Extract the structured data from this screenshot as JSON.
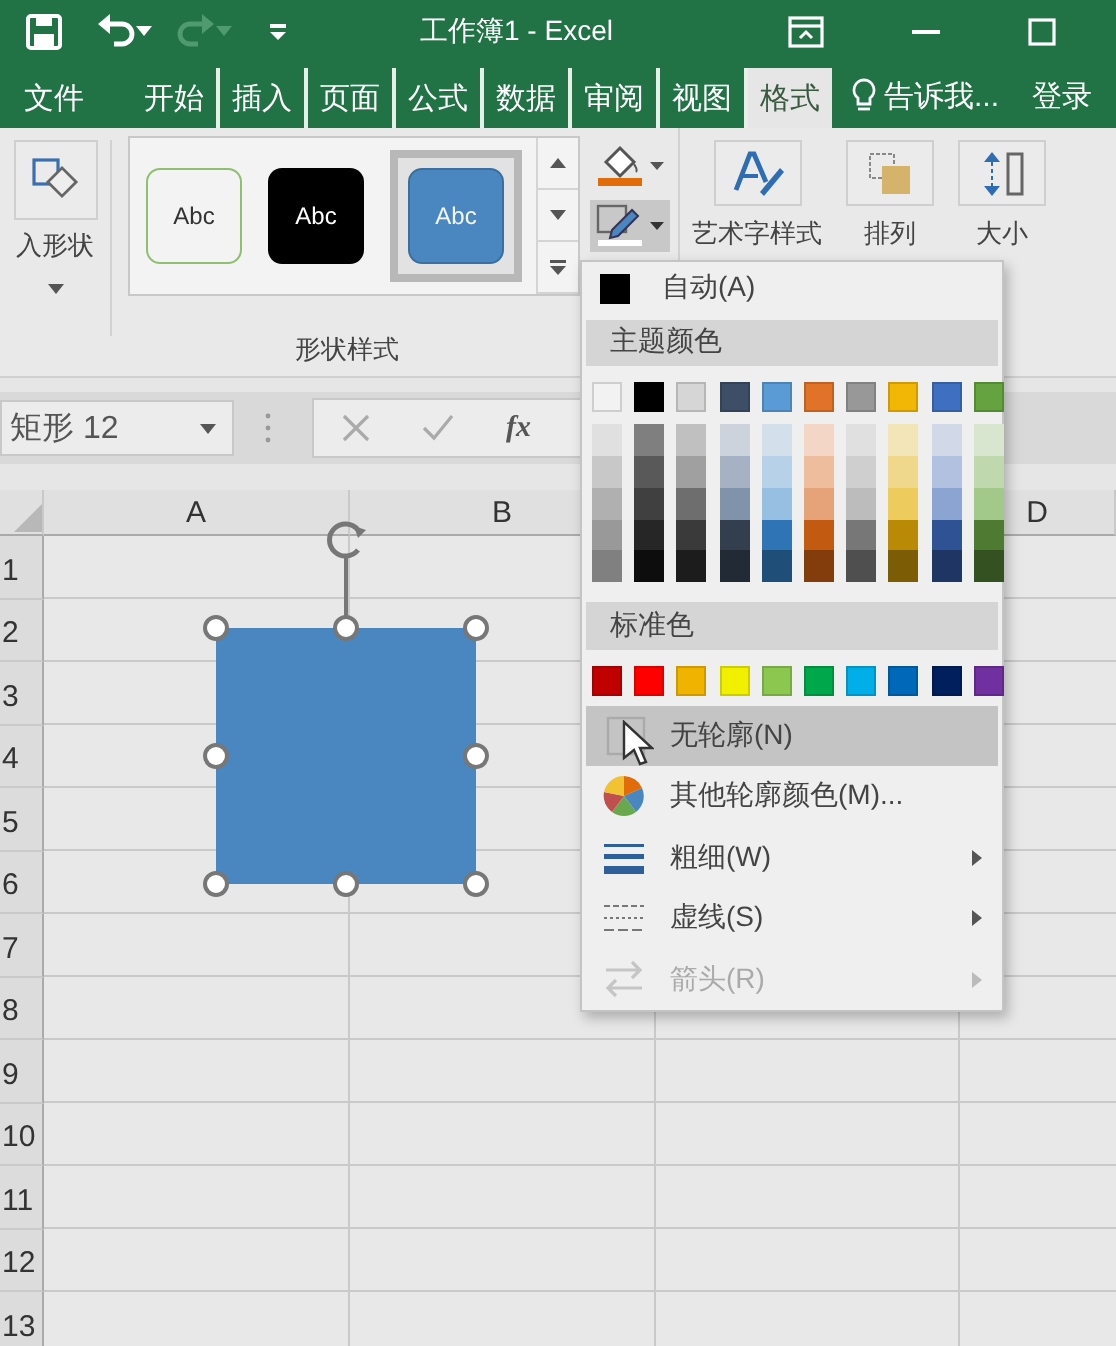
{
  "title_bar": {
    "title": "工作簿1 - Excel"
  },
  "ribbon_tabs": [
    {
      "label": "文件",
      "selected": false
    },
    {
      "label": "开始",
      "selected": false
    },
    {
      "label": "插入",
      "selected": false
    },
    {
      "label": "页面",
      "selected": false
    },
    {
      "label": "公式",
      "selected": false
    },
    {
      "label": "数据",
      "selected": false
    },
    {
      "label": "审阅",
      "selected": false
    },
    {
      "label": "视图",
      "selected": false
    },
    {
      "label": "格式",
      "selected": true
    }
  ],
  "tell_me": {
    "label": "告诉我..."
  },
  "sign_in": {
    "label": "登录"
  },
  "ribbon": {
    "insert_shapes": {
      "label": "入形状"
    },
    "shape_styles": {
      "label": "形状样式",
      "styles": [
        {
          "kind": "outline",
          "label": "Abc",
          "selected": false
        },
        {
          "kind": "dark",
          "label": "Abc",
          "selected": false
        },
        {
          "kind": "filled",
          "label": "Abc",
          "selected": true
        }
      ]
    },
    "shape_outline": {
      "pressed": true
    },
    "buttons": [
      {
        "kind": "wordart",
        "label": "艺术字样式"
      },
      {
        "kind": "arrange",
        "label": "排列"
      },
      {
        "kind": "size",
        "label": "大小"
      }
    ]
  },
  "formula_bar": {
    "name_box": "矩形 12",
    "fx_label": "fx"
  },
  "sheet": {
    "columns": [
      {
        "label": "A"
      },
      {
        "label": "B"
      },
      {
        "label": "D"
      }
    ],
    "rows": [
      "1",
      "2",
      "3",
      "4",
      "5",
      "6",
      "7",
      "8",
      "9",
      "10",
      "11",
      "12",
      "13"
    ],
    "shape": {
      "kind": "rectangle",
      "selected": true
    }
  },
  "outline_menu": {
    "auto": {
      "label": "自动(A)"
    },
    "theme_header": "主题颜色",
    "theme_colors": [
      {
        "color": "#f2f2f2",
        "shades": [
          {
            "color": "#e0e0e0"
          },
          {
            "color": "#c8c8c8"
          },
          {
            "color": "#b0b0b0"
          },
          {
            "color": "#999999"
          },
          {
            "color": "#808080"
          }
        ]
      },
      {
        "color": "#000000",
        "shades": [
          {
            "color": "#7f7f7f"
          },
          {
            "color": "#595959"
          },
          {
            "color": "#404040"
          },
          {
            "color": "#262626"
          },
          {
            "color": "#0d0d0d"
          }
        ]
      },
      {
        "color": "#d6d6d6",
        "shades": [
          {
            "color": "#c0c0c0"
          },
          {
            "color": "#a0a0a0"
          },
          {
            "color": "#6e6e6e"
          },
          {
            "color": "#3a3a3a"
          },
          {
            "color": "#1c1c1c"
          }
        ]
      },
      {
        "color": "#3d4e66",
        "shades": [
          {
            "color": "#ccd3dd"
          },
          {
            "color": "#a6b2c3"
          },
          {
            "color": "#8093ab"
          },
          {
            "color": "#333f4f"
          },
          {
            "color": "#222b35"
          }
        ]
      },
      {
        "color": "#5b9bd5",
        "shades": [
          {
            "color": "#d3e0ec"
          },
          {
            "color": "#b7d1e8"
          },
          {
            "color": "#97bfe2"
          },
          {
            "color": "#2f75b5"
          },
          {
            "color": "#1f4e78"
          }
        ]
      },
      {
        "color": "#e07328",
        "shades": [
          {
            "color": "#f3d6c5"
          },
          {
            "color": "#eebd9e"
          },
          {
            "color": "#e6a37a"
          },
          {
            "color": "#c35a11"
          },
          {
            "color": "#833c0b"
          }
        ]
      },
      {
        "color": "#989898",
        "shades": [
          {
            "color": "#e0e0e0"
          },
          {
            "color": "#cfcfcf"
          },
          {
            "color": "#bcbcbc"
          },
          {
            "color": "#777777"
          },
          {
            "color": "#4f4f4f"
          }
        ]
      },
      {
        "color": "#f2b705",
        "shades": [
          {
            "color": "#f2e5b8"
          },
          {
            "color": "#efd78c"
          },
          {
            "color": "#edcb5c"
          },
          {
            "color": "#b88a05"
          },
          {
            "color": "#7c5d05"
          }
        ]
      },
      {
        "color": "#3f6fc0",
        "shades": [
          {
            "color": "#d1d9e8"
          },
          {
            "color": "#b1c1df"
          },
          {
            "color": "#8ca4d2"
          },
          {
            "color": "#2f5294"
          },
          {
            "color": "#1f3664"
          }
        ]
      },
      {
        "color": "#64a33f",
        "shades": [
          {
            "color": "#d8e5cf"
          },
          {
            "color": "#bfd8ad"
          },
          {
            "color": "#a2c98a"
          },
          {
            "color": "#4e7a31"
          },
          {
            "color": "#345221"
          }
        ]
      }
    ],
    "standard_header": "标准色",
    "standard_colors": [
      {
        "color": "#c00000"
      },
      {
        "color": "#ff0000"
      },
      {
        "color": "#f0b400"
      },
      {
        "color": "#f0f000"
      },
      {
        "color": "#8cc850"
      },
      {
        "color": "#00a84c"
      },
      {
        "color": "#00aee8"
      },
      {
        "color": "#0068b8"
      },
      {
        "color": "#001f5c"
      },
      {
        "color": "#7030a0"
      }
    ],
    "items": [
      {
        "kind": "none",
        "label": "无轮廓(N)",
        "selected": true,
        "disabled": false,
        "submenu": false
      },
      {
        "kind": "more",
        "label": "其他轮廓颜色(M)...",
        "selected": false,
        "disabled": false,
        "submenu": false
      },
      {
        "kind": "weight",
        "label": "粗细(W)",
        "selected": false,
        "disabled": false,
        "submenu": true
      },
      {
        "kind": "dash",
        "label": "虚线(S)",
        "selected": false,
        "disabled": false,
        "submenu": true
      },
      {
        "kind": "arrow",
        "label": "箭头(R)",
        "selected": false,
        "disabled": true,
        "submenu": true
      }
    ]
  }
}
